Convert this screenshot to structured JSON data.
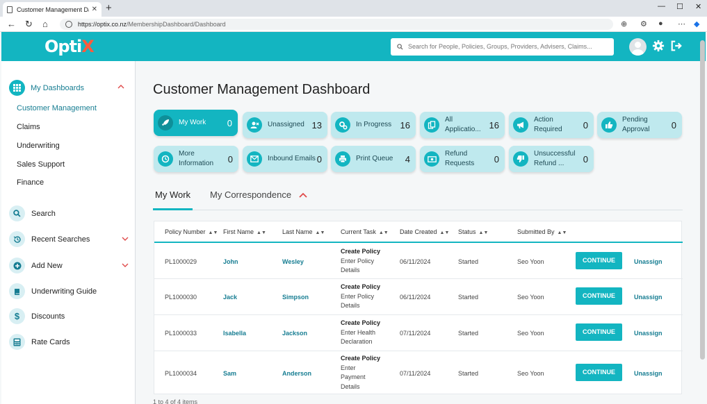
{
  "browser": {
    "tab_title": "Customer Management Dashboard",
    "new_tab": "+",
    "url_host": "https://optix.co.nz",
    "url_path": "/MembershipDashboard/Dashboard"
  },
  "header": {
    "logo_main": "Opti",
    "logo_accent": "X",
    "search_placeholder": "Search for People, Policies, Groups, Providers, Advisers, Claims..."
  },
  "sidebar": {
    "dashboards_label": "My Dashboards",
    "dashboard_items": [
      "Customer Management",
      "Claims",
      "Underwriting",
      "Sales Support",
      "Finance"
    ],
    "nav": [
      {
        "label": "Search",
        "icon": "search-icon"
      },
      {
        "label": "Recent Searches",
        "icon": "history-icon"
      },
      {
        "label": "Add New",
        "icon": "plus-circle-icon"
      },
      {
        "label": "Underwriting Guide",
        "icon": "book-icon"
      },
      {
        "label": "Discounts",
        "icon": "dollar-icon"
      },
      {
        "label": "Rate Cards",
        "icon": "calculator-icon"
      }
    ]
  },
  "main": {
    "title": "Customer Management Dashboard",
    "tiles": [
      {
        "label": "My Work",
        "count": "0",
        "icon": "rocket-icon"
      },
      {
        "label": "Unassigned",
        "count": "13",
        "icon": "user-x-icon"
      },
      {
        "label": "In Progress",
        "count": "16",
        "icon": "cogs-icon"
      },
      {
        "label": "All Applicatio...",
        "count": "16",
        "icon": "documents-icon"
      },
      {
        "label": "Action Required",
        "count": "0",
        "icon": "megaphone-icon"
      },
      {
        "label": "Pending Approval",
        "count": "0",
        "icon": "thumbs-up-icon"
      },
      {
        "label": "More Information",
        "count": "0",
        "icon": "clock-icon"
      },
      {
        "label": "Inbound Emails",
        "count": "0",
        "icon": "envelope-icon"
      },
      {
        "label": "Print Queue",
        "count": "4",
        "icon": "printer-icon"
      },
      {
        "label": "Refund Requests",
        "count": "0",
        "icon": "money-icon"
      },
      {
        "label": "Unsuccessful Refund ...",
        "count": "0",
        "icon": "thumbs-down-icon"
      }
    ],
    "tabs": [
      "My Work",
      "My Correspondence"
    ],
    "columns": [
      "Policy Number",
      "First Name",
      "Last Name",
      "Current Task",
      "Date Created",
      "Status",
      "Submitted By"
    ],
    "rows": [
      {
        "policy": "PL1000029",
        "first": "John",
        "last": "Wesley",
        "task_title": "Create Policy",
        "task_detail": "Enter Policy Details",
        "date": "06/11/2024",
        "status": "Started",
        "submitted": "Seo Yoon"
      },
      {
        "policy": "PL1000030",
        "first": "Jack",
        "last": "Simpson",
        "task_title": "Create Policy",
        "task_detail": "Enter Policy Details",
        "date": "06/11/2024",
        "status": "Started",
        "submitted": "Seo Yoon"
      },
      {
        "policy": "PL1000033",
        "first": "Isabella",
        "last": "Jackson",
        "task_title": "Create Policy",
        "task_detail": "Enter Health Declaration",
        "date": "07/11/2024",
        "status": "Started",
        "submitted": "Seo Yoon"
      },
      {
        "policy": "PL1000034",
        "first": "Sam",
        "last": "Anderson",
        "task_title": "Create Policy",
        "task_detail": "Enter Payment Details",
        "date": "07/11/2024",
        "status": "Started",
        "submitted": "Seo Yoon"
      }
    ],
    "continue_label": "CONTINUE",
    "unassign_label": "Unassign",
    "footer": "1 to 4 of 4 items"
  }
}
